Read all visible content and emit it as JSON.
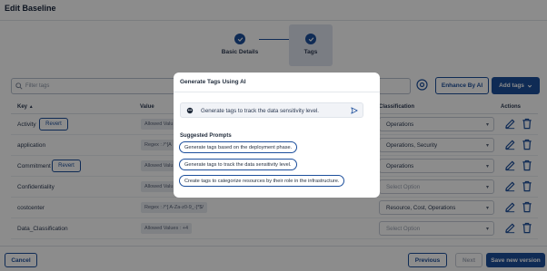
{
  "page": {
    "title": "Edit Baseline"
  },
  "stepper": {
    "steps": [
      {
        "label": "Basic Details",
        "state": "complete"
      },
      {
        "label": "Tags",
        "state": "active"
      }
    ]
  },
  "toolbar": {
    "filter_placeholder": "Filter tags",
    "enhance_label": "Enhance By AI",
    "add_tags_label": "Add tags"
  },
  "table": {
    "headers": {
      "key": "Key",
      "value": "Value",
      "classification": "Classification",
      "actions": "Actions"
    },
    "revert_label": "Revert",
    "rows": [
      {
        "key": "Activity",
        "revert": true,
        "value": "Allowed Valu",
        "classification": "Operations",
        "placeholder": false
      },
      {
        "key": "application",
        "revert": false,
        "value": "Regex : /^[A",
        "classification": "Operations, Security",
        "placeholder": false
      },
      {
        "key": "Commitment",
        "revert": true,
        "value": "Allowed Valu",
        "classification": "Operations",
        "placeholder": false
      },
      {
        "key": "Confidentiality",
        "revert": false,
        "value": "Allowed Valu",
        "classification": "Select Option",
        "placeholder": true
      },
      {
        "key": "costcenter",
        "revert": false,
        "value": "Regex : /^[ A-Za-z0-9_-]*$/",
        "classification": "Resource, Cost, Operations",
        "placeholder": false
      },
      {
        "key": "Data_Classification",
        "revert": false,
        "value": "Allowed Values : +4",
        "classification": "Select Option",
        "placeholder": true
      }
    ]
  },
  "footer": {
    "cancel_label": "Cancel",
    "previous_label": "Previous",
    "next_label": "Next",
    "save_label": "Save new version"
  },
  "modal": {
    "title": "Generate Tags Using AI",
    "prompt_value": "Generate tags to track the data sensitivity level.",
    "suggested_title": "Suggested Prompts",
    "suggestions": [
      "Generate tags based on the deployment phase.",
      "Generate tags to track the data sensitivity level.",
      "Create tags to categorize resources by their role in the infrastructure."
    ]
  },
  "colors": {
    "primary": "#1d4f9c",
    "overlay": "rgba(0,0,0,0.45)"
  },
  "icons": [
    "check-icon",
    "search-icon",
    "sync-icon",
    "chevron-down-icon",
    "sort-up-icon",
    "edit-icon",
    "delete-icon",
    "bot-icon",
    "send-icon"
  ]
}
